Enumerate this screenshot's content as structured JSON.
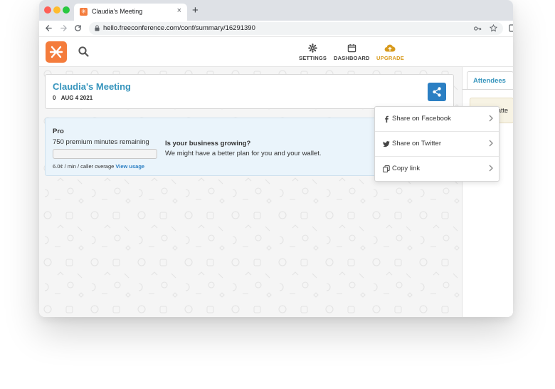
{
  "browser": {
    "tab_title": "Claudia's Meeting",
    "tab_close": "×",
    "new_tab": "+",
    "url": "hello.freeconference.com/conf/summary/16291390"
  },
  "header": {
    "nav": [
      {
        "label": "SETTINGS",
        "icon": "gear-icon"
      },
      {
        "label": "DASHBOARD",
        "icon": "calendar-icon"
      },
      {
        "label": "UPGRADE",
        "icon": "cloud-upload-icon"
      }
    ],
    "colors": {
      "brand": "#f47c3c",
      "accent": "#3795bd",
      "upgrade": "#d89b1e",
      "button": "#2b7fc3"
    }
  },
  "meeting": {
    "title": "Claudia's Meeting",
    "count": "0",
    "date": "AUG 4 2021"
  },
  "plan": {
    "name": "Pro",
    "minutes": "750 premium minutes remaining",
    "rate": "6.0¢ / min / caller overage",
    "view_usage": "View usage",
    "promo_title": "Is your business growing?",
    "promo_text": "We might have a better plan for you and your wallet."
  },
  "share_menu": {
    "items": [
      {
        "label": "Share on Facebook",
        "icon": "facebook-icon"
      },
      {
        "label": "Share on Twitter",
        "icon": "twitter-icon"
      },
      {
        "label": "Copy link",
        "icon": "copy-link-icon"
      }
    ]
  },
  "attendees": {
    "tab_label": "Attendees",
    "note": "atte"
  }
}
